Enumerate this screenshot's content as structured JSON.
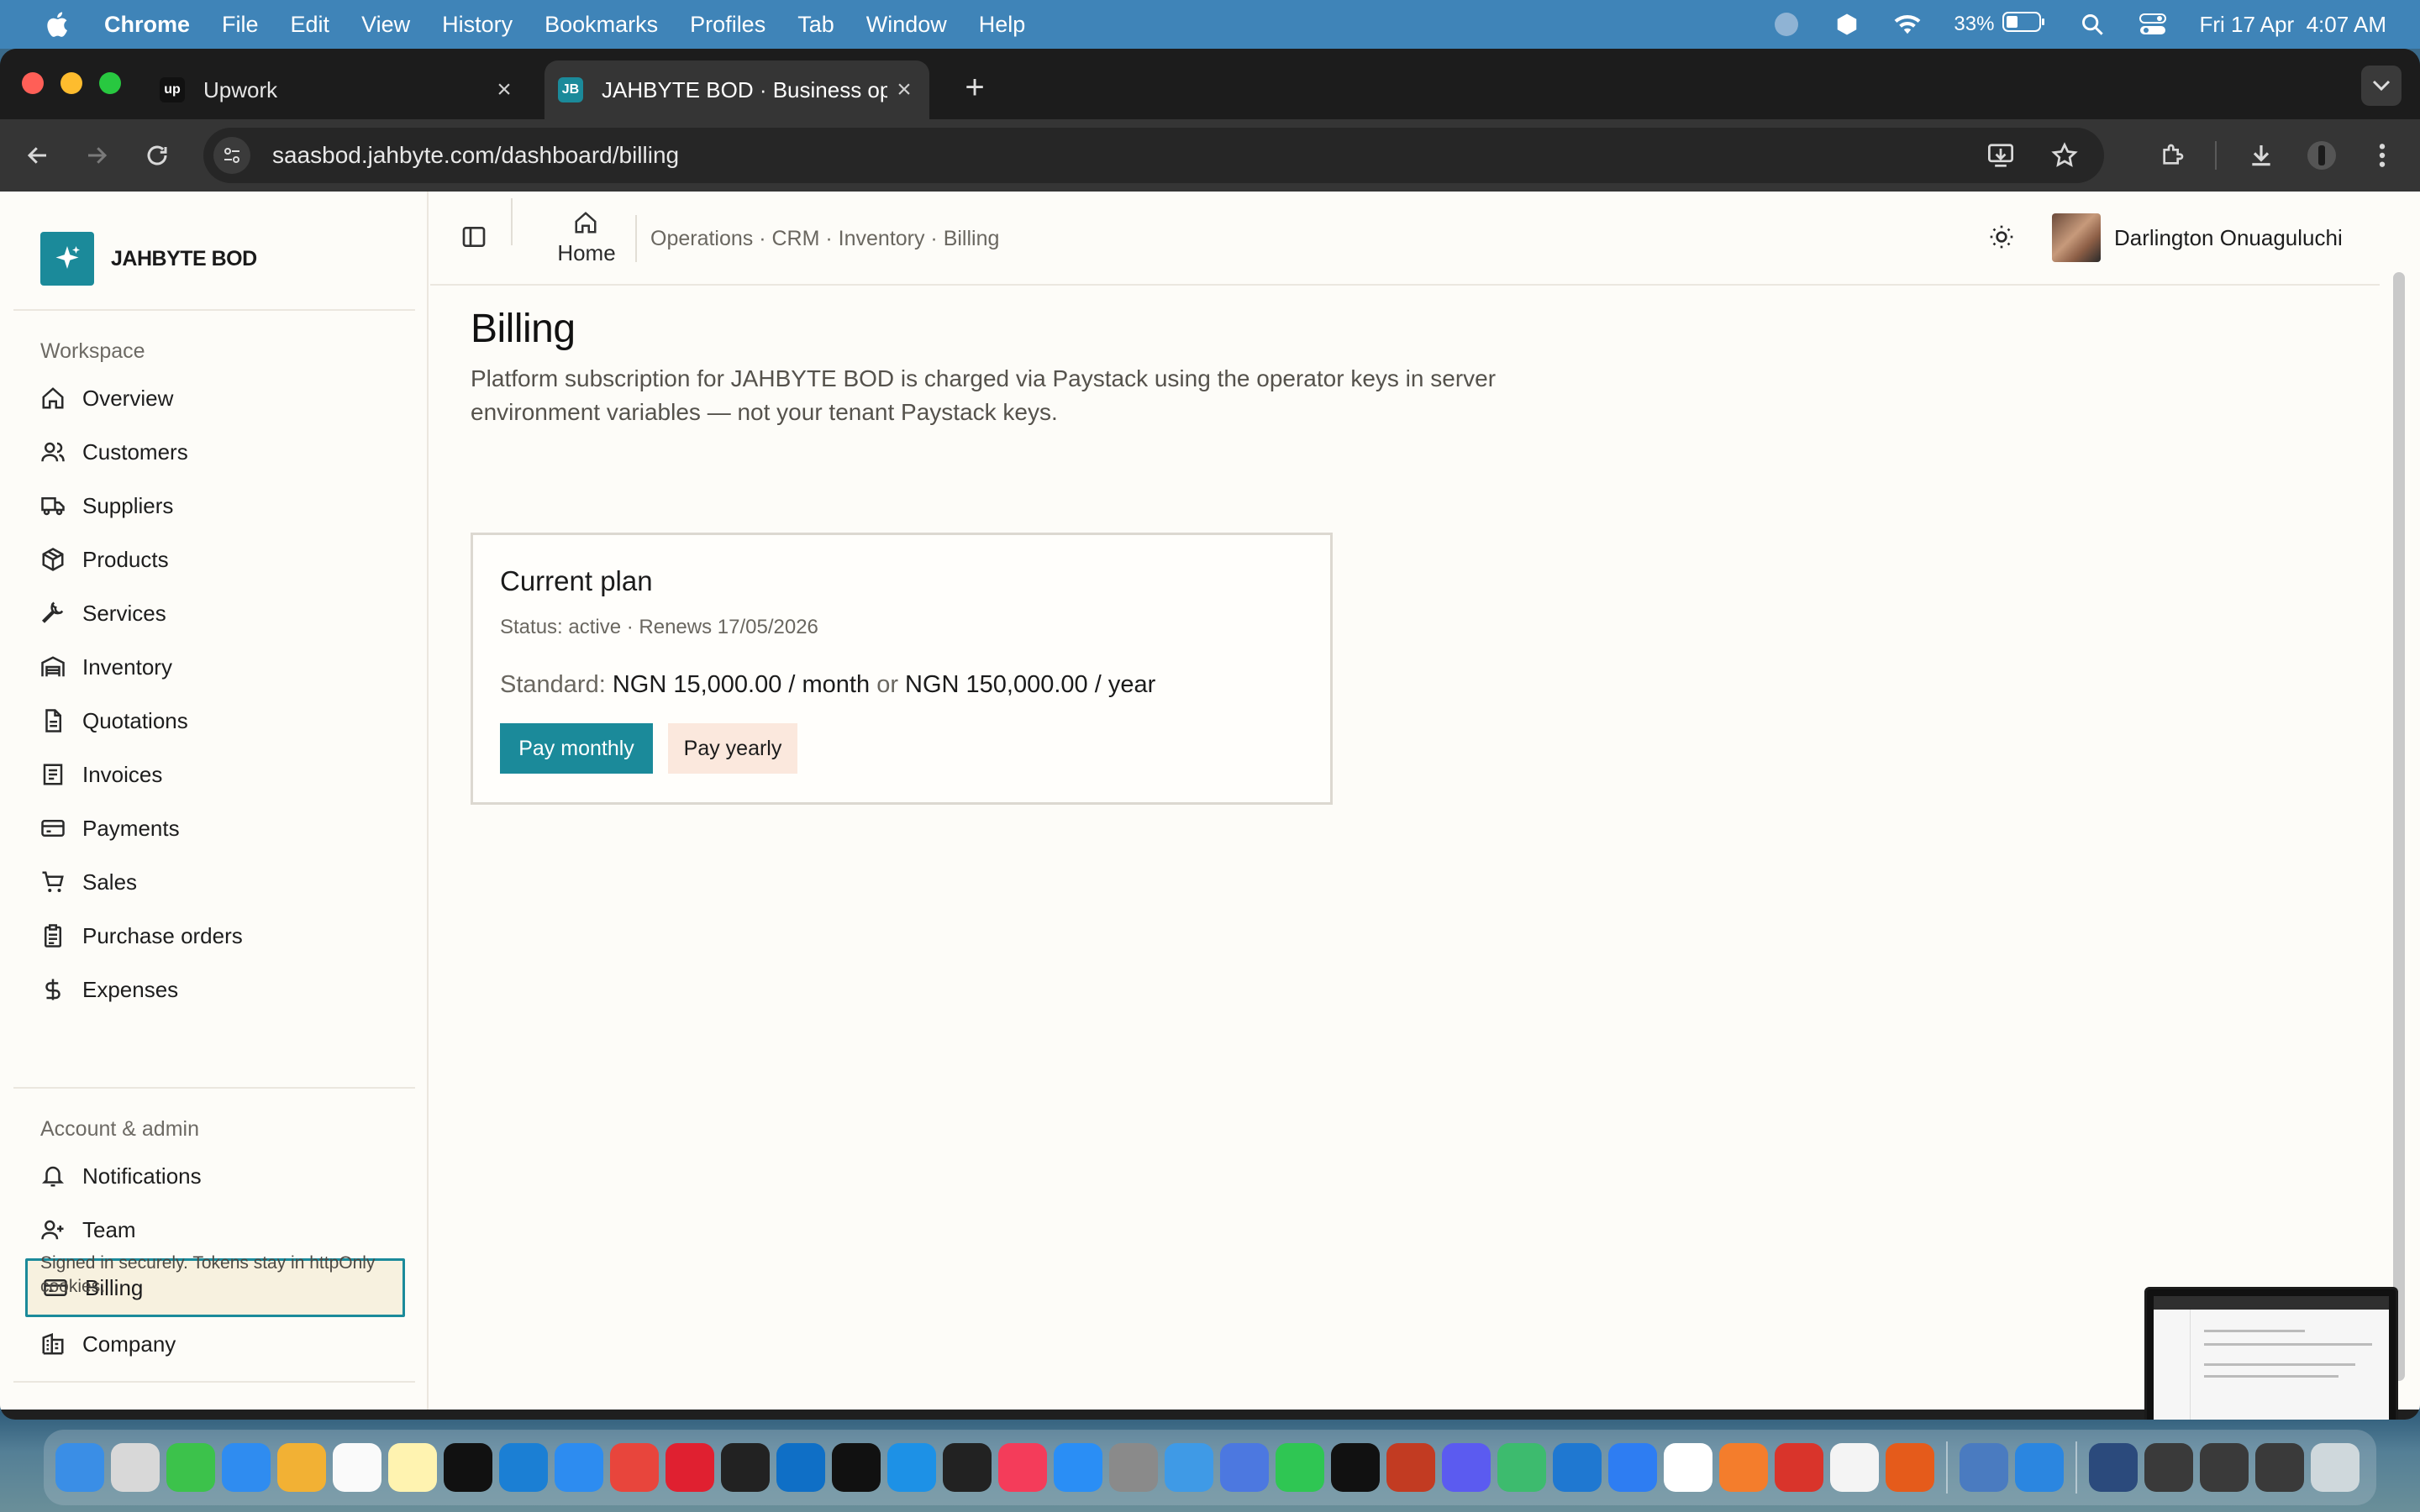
{
  "menubar": {
    "app": "Chrome",
    "items": [
      "File",
      "Edit",
      "View",
      "History",
      "Bookmarks",
      "Profiles",
      "Tab",
      "Window",
      "Help"
    ],
    "battery": "33%",
    "datetime": "Fri 17 Apr  4:07 AM"
  },
  "browser": {
    "tabs": [
      {
        "title": "Upwork",
        "favicon": "up"
      },
      {
        "title": "JAHBYTE BOD · Business ope",
        "favicon": "JB"
      }
    ],
    "new_tab": "+",
    "url": "saasbod.jahbyte.com/dashboard/billing"
  },
  "sidebar": {
    "brand": "JAHBYTE BOD",
    "workspace_label": "Workspace",
    "workspace_items": [
      {
        "label": "Overview",
        "icon": "home-icon"
      },
      {
        "label": "Customers",
        "icon": "users-icon"
      },
      {
        "label": "Suppliers",
        "icon": "truck-icon"
      },
      {
        "label": "Products",
        "icon": "package-icon"
      },
      {
        "label": "Services",
        "icon": "wrench-icon"
      },
      {
        "label": "Inventory",
        "icon": "warehouse-icon"
      },
      {
        "label": "Quotations",
        "icon": "document-icon"
      },
      {
        "label": "Invoices",
        "icon": "receipt-icon"
      },
      {
        "label": "Payments",
        "icon": "credit-card-icon"
      },
      {
        "label": "Sales",
        "icon": "cart-icon"
      },
      {
        "label": "Purchase orders",
        "icon": "clipboard-icon"
      },
      {
        "label": "Expenses",
        "icon": "dollar-icon"
      }
    ],
    "admin_label": "Account & admin",
    "admin_items": [
      {
        "label": "Notifications",
        "icon": "bell-icon"
      },
      {
        "label": "Team",
        "icon": "user-plus-icon"
      },
      {
        "label": "Billing",
        "icon": "credit-card-icon",
        "active": true
      },
      {
        "label": "Company",
        "icon": "building-icon"
      }
    ],
    "footer": "Signed in securely. Tokens stay in httpOnly cookies."
  },
  "header": {
    "home_label": "Home",
    "breadcrumb": "Operations · CRM · Inventory · Billing",
    "user_name": "Darlington Onuaguluchi"
  },
  "billing": {
    "title": "Billing",
    "description": "Platform subscription for JAHBYTE BOD is charged via Paystack using the operator keys in server environment variables — not your tenant Paystack keys.",
    "card": {
      "title": "Current plan",
      "status": "Status: active · Renews 17/05/2026",
      "plan_prefix": "Standard:",
      "monthly_price": "NGN 15,000.00 / month",
      "or": "or",
      "yearly_price": "NGN 150,000.00 / year",
      "pay_monthly": "Pay monthly",
      "pay_yearly": "Pay yearly"
    }
  },
  "colors": {
    "accent": "#1b8a9a",
    "active_bg": "#f7f1df",
    "secondary_btn": "#fbe8dd",
    "menubar": "#3f84b8"
  }
}
